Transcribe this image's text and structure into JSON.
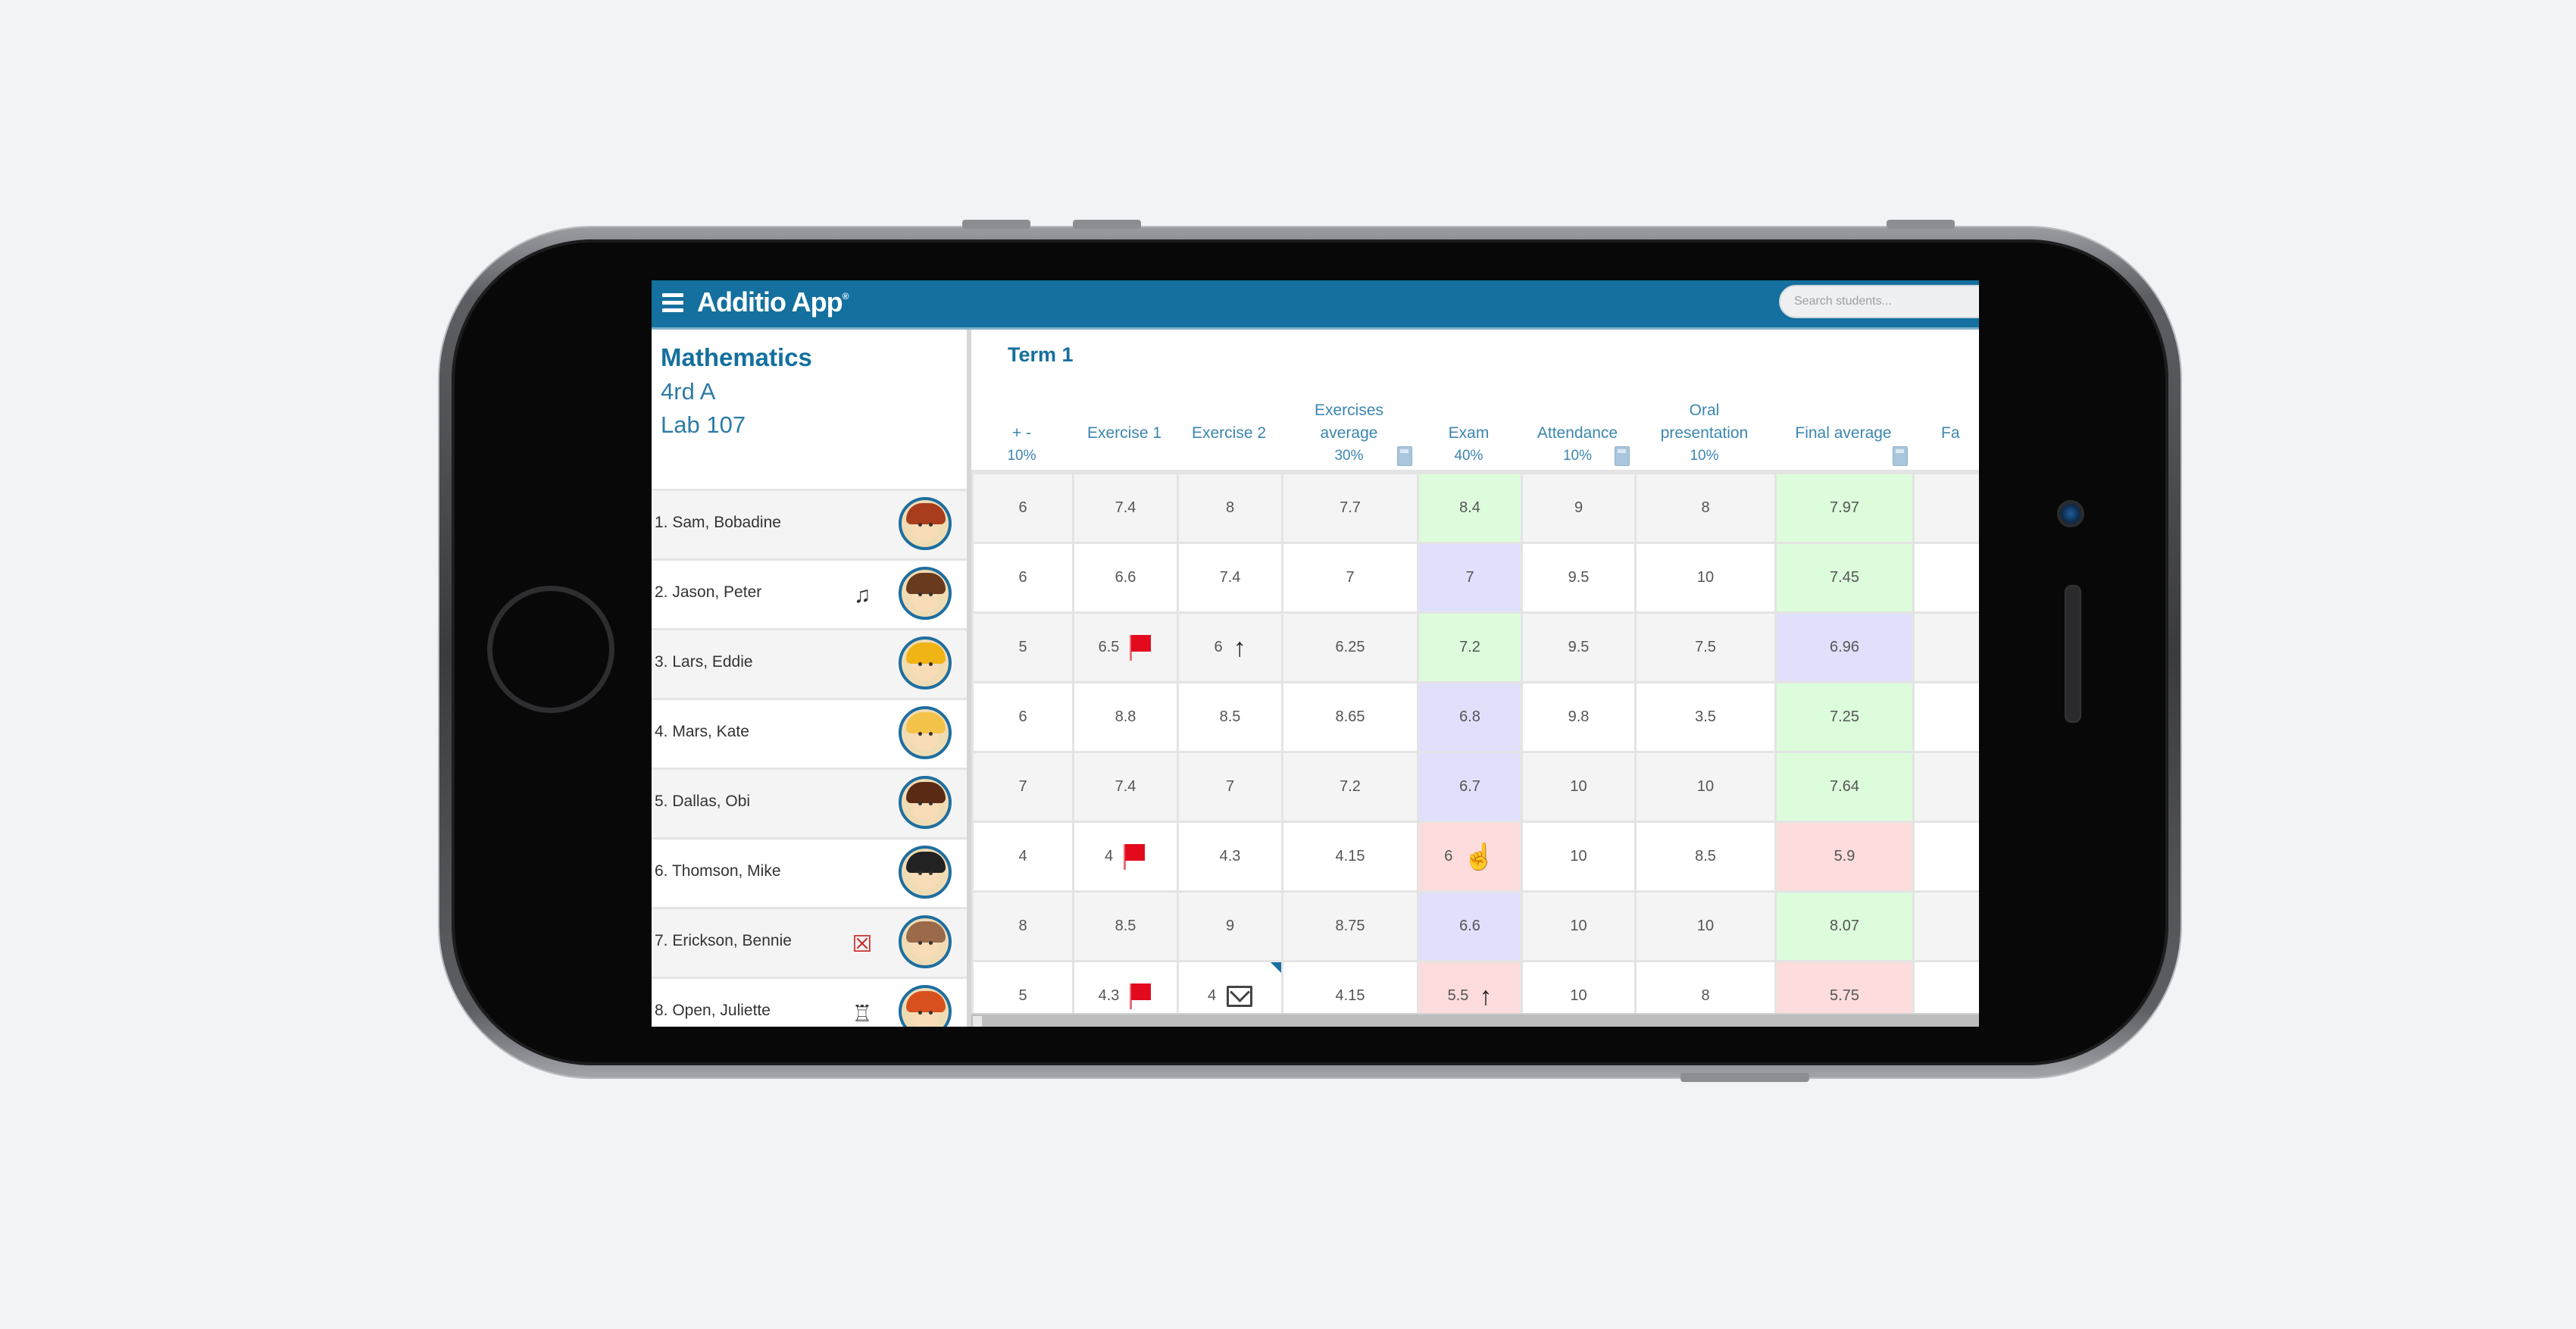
{
  "app": {
    "title": "Additio App",
    "title_mark": "®",
    "search_placeholder": "Search students..."
  },
  "course": {
    "subject": "Mathematics",
    "group": "4rd A",
    "room": "Lab 107"
  },
  "term": "Term 1",
  "columns": [
    {
      "label": "+ -",
      "weight": "10%",
      "calc": false
    },
    {
      "label": "Exercise 1",
      "weight": "",
      "calc": false
    },
    {
      "label": "Exercise 2",
      "weight": "",
      "calc": false
    },
    {
      "label": "Exercises average",
      "weight": "30%",
      "calc": true
    },
    {
      "label": "Exam",
      "weight": "40%",
      "calc": false
    },
    {
      "label": "Attendance",
      "weight": "10%",
      "calc": true
    },
    {
      "label": "Oral presentation",
      "weight": "10%",
      "calc": false
    },
    {
      "label": "Final average",
      "weight": "",
      "calc": true
    },
    {
      "label": "Fa",
      "weight": "",
      "calc": false
    }
  ],
  "students": [
    {
      "name": "1. Sam, Bobadine",
      "badge": "",
      "avatar": {
        "hair": "#a83c1c"
      },
      "grades": [
        "6",
        "7.4",
        "8",
        "7.7",
        "8.4",
        "9",
        "8",
        "7.97",
        ""
      ],
      "colors": [
        "",
        "",
        "",
        "",
        "green",
        "",
        "",
        "green",
        ""
      ]
    },
    {
      "name": "2. Jason, Peter",
      "badge": "musical-note-icon",
      "avatar": {
        "hair": "#6a3a1e"
      },
      "grades": [
        "6",
        "6.6",
        "7.4",
        "7",
        "7",
        "9.5",
        "10",
        "7.45",
        ""
      ],
      "colors": [
        "",
        "",
        "",
        "",
        "blue",
        "",
        "",
        "green",
        ""
      ]
    },
    {
      "name": "3. Lars, Eddie",
      "badge": "",
      "avatar": {
        "hair": "#f0b414"
      },
      "grades": [
        "5",
        "6.5",
        "6",
        "6.25",
        "7.2",
        "9.5",
        "7.5",
        "6.96",
        ""
      ],
      "colors": [
        "",
        "",
        "",
        "",
        "green",
        "",
        "",
        "blue",
        ""
      ],
      "icons": {
        "1": "flag",
        "2": "arrow-up"
      }
    },
    {
      "name": "4. Mars, Kate",
      "badge": "",
      "avatar": {
        "hair": "#f4c44a"
      },
      "grades": [
        "6",
        "8.8",
        "8.5",
        "8.65",
        "6.8",
        "9.8",
        "3.5",
        "7.25",
        ""
      ],
      "colors": [
        "",
        "",
        "",
        "",
        "blue",
        "",
        "",
        "green",
        ""
      ]
    },
    {
      "name": "5. Dallas, Obi",
      "badge": "",
      "avatar": {
        "hair": "#5a2a14"
      },
      "grades": [
        "7",
        "7.4",
        "7",
        "7.2",
        "6.7",
        "10",
        "10",
        "7.64",
        ""
      ],
      "colors": [
        "",
        "",
        "",
        "",
        "blue",
        "",
        "",
        "green",
        ""
      ]
    },
    {
      "name": "6. Thomson, Mike",
      "badge": "",
      "avatar": {
        "hair": "#222222"
      },
      "grades": [
        "4",
        "4",
        "4.3",
        "4.15",
        "6",
        "10",
        "8.5",
        "5.9",
        ""
      ],
      "colors": [
        "",
        "",
        "",
        "",
        "red",
        "",
        "",
        "red",
        ""
      ],
      "icons": {
        "1": "flag",
        "4": "thumbs-up"
      }
    },
    {
      "name": "7. Erickson, Bennie",
      "badge": "no-photo-icon",
      "avatar": {
        "hair": "#9a6a4a"
      },
      "grades": [
        "8",
        "8.5",
        "9",
        "8.75",
        "6.6",
        "10",
        "10",
        "8.07",
        ""
      ],
      "colors": [
        "",
        "",
        "",
        "",
        "blue",
        "",
        "",
        "green",
        ""
      ]
    },
    {
      "name": "8. Open, Juliette",
      "badge": "teacher-desk-icon",
      "avatar": {
        "hair": "#d8501e"
      },
      "grades": [
        "5",
        "4.3",
        "4",
        "4.15",
        "5.5",
        "10",
        "8",
        "5.75",
        ""
      ],
      "colors": [
        "",
        "",
        "",
        "",
        "red",
        "",
        "",
        "red",
        ""
      ],
      "icons": {
        "1": "flag",
        "2": "mail",
        "4": "arrow-up"
      },
      "comment_marker_col": 2
    }
  ],
  "colors": {
    "brand": "#14709e",
    "good": "#dcfcdc",
    "average": "#e0e0fc",
    "low": "#fcdcdc",
    "flag": "#e30a1e"
  }
}
